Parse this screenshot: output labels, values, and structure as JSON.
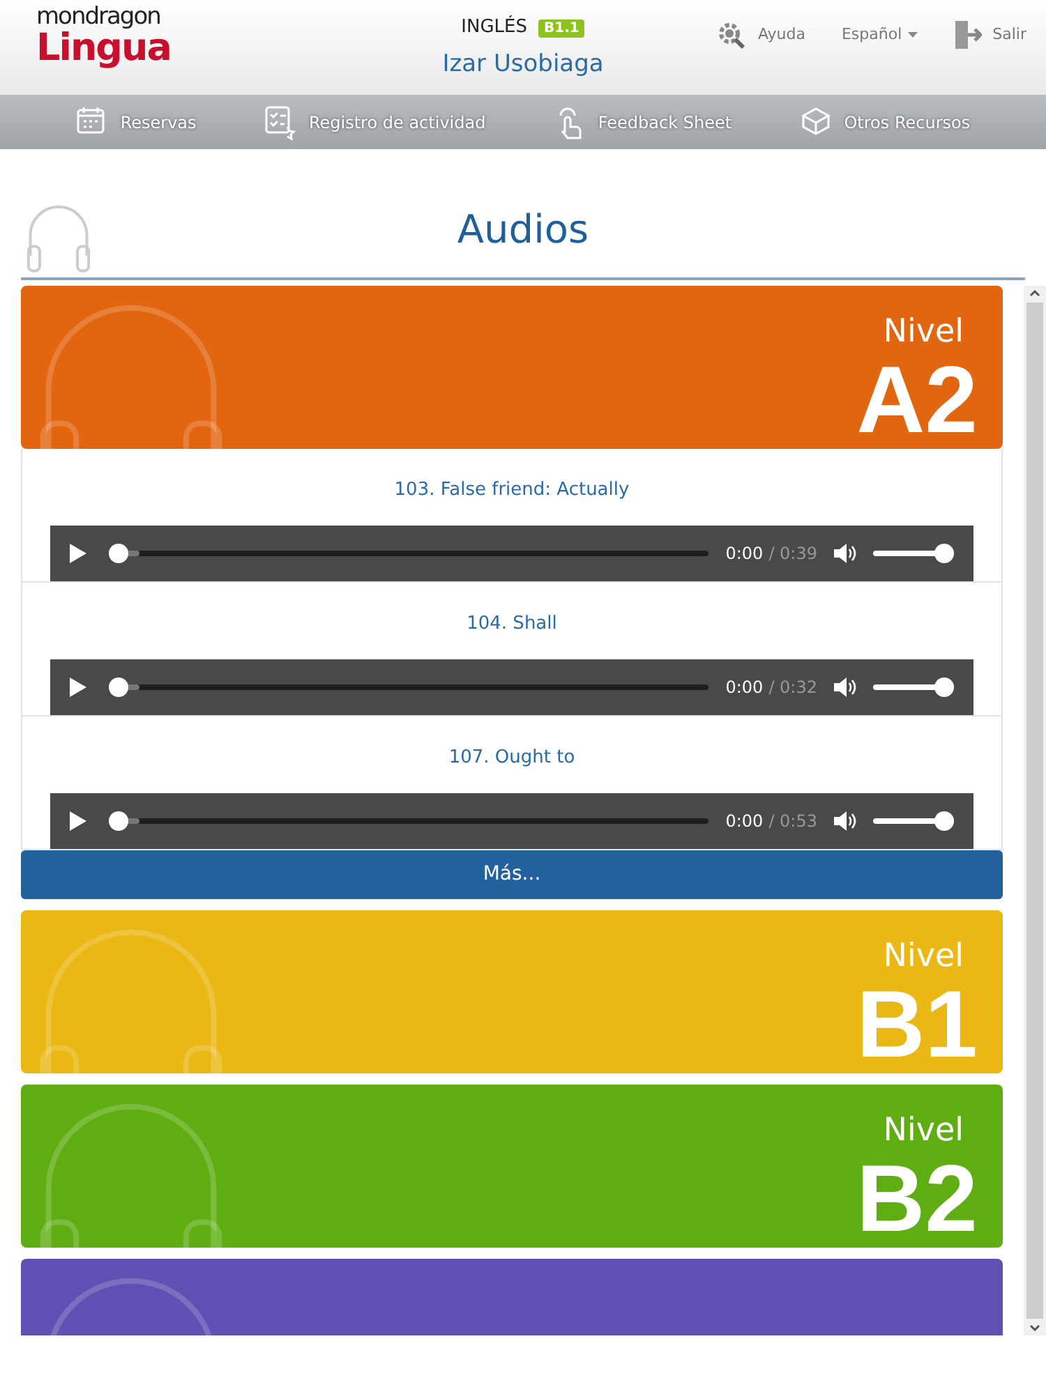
{
  "header": {
    "logo_top": "mondragon",
    "logo_bottom": "Lingua",
    "language": "INGLÉS",
    "level_badge": "B1.1",
    "user": "Izar Usobiaga",
    "help": "Ayuda",
    "language_menu": "Español",
    "logout": "Salir"
  },
  "nav": [
    {
      "label": "Reservas",
      "kind": "calendar"
    },
    {
      "label": "Registro de actividad",
      "kind": "checklist"
    },
    {
      "label": "Feedback Sheet",
      "kind": "hand"
    },
    {
      "label": "Otros Recursos",
      "kind": "box"
    }
  ],
  "page_title": "Audios",
  "levels": [
    {
      "label": "Nivel",
      "code": "A2",
      "color": "#e2650f",
      "more": "Más...",
      "audios": [
        {
          "title": "103. False friend: Actually",
          "current": "0:00",
          "duration": "/ 0:39",
          "progress": {
            "level": 0
          },
          "volume": {
            "level": 1
          }
        },
        {
          "title": "104. Shall",
          "current": "0:00",
          "duration": "/ 0:32",
          "progress": {
            "level": 0
          },
          "volume": {
            "level": 1
          }
        },
        {
          "title": "107. Ought to",
          "current": "0:00",
          "duration": "/ 0:53",
          "progress": {
            "level": 0
          },
          "volume": {
            "level": 1
          }
        }
      ]
    },
    {
      "label": "Nivel",
      "code": "B1",
      "color": "#eab714"
    },
    {
      "label": "Nivel",
      "code": "B2",
      "color": "#5eae13"
    },
    {
      "color": "#6150b3"
    }
  ]
}
